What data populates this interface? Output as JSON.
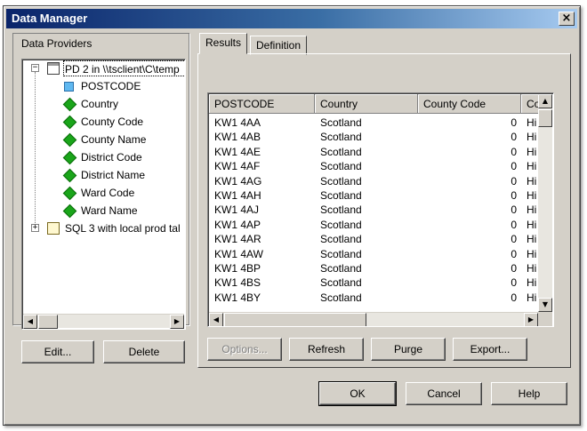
{
  "window": {
    "title": "Data Manager",
    "close_label": "×"
  },
  "providers": {
    "group_label": "Data Providers",
    "tree": [
      {
        "label": "PD 2 in \\\\tsclient\\C\\temp",
        "expander": "−",
        "children": [
          "POSTCODE",
          "Country",
          "County Code",
          "County Name",
          "District Code",
          "District Name",
          "Ward Code",
          "Ward Name"
        ]
      },
      {
        "label": "SQL 3 with local prod tal",
        "expander": "+"
      }
    ],
    "buttons": {
      "edit": "Edit...",
      "delete": "Delete"
    }
  },
  "tabs": {
    "results": "Results",
    "definition": "Definition"
  },
  "grid": {
    "columns": [
      "POSTCODE",
      "Country",
      "County Code",
      "Co"
    ],
    "rows": [
      [
        "KW1 4AA",
        "Scotland",
        "0",
        "Hi"
      ],
      [
        "KW1 4AB",
        "Scotland",
        "0",
        "Hi"
      ],
      [
        "KW1 4AE",
        "Scotland",
        "0",
        "Hi"
      ],
      [
        "KW1 4AF",
        "Scotland",
        "0",
        "Hi"
      ],
      [
        "KW1 4AG",
        "Scotland",
        "0",
        "Hi"
      ],
      [
        "KW1 4AH",
        "Scotland",
        "0",
        "Hi"
      ],
      [
        "KW1 4AJ",
        "Scotland",
        "0",
        "Hi"
      ],
      [
        "KW1 4AP",
        "Scotland",
        "0",
        "Hi"
      ],
      [
        "KW1 4AR",
        "Scotland",
        "0",
        "Hi"
      ],
      [
        "KW1 4AW",
        "Scotland",
        "0",
        "Hi"
      ],
      [
        "KW1 4BP",
        "Scotland",
        "0",
        "Hi"
      ],
      [
        "KW1 4BS",
        "Scotland",
        "0",
        "Hi"
      ],
      [
        "KW1 4BY",
        "Scotland",
        "0",
        "Hi"
      ]
    ]
  },
  "actions": {
    "options": "Options...",
    "refresh": "Refresh",
    "purge": "Purge",
    "export": "Export..."
  },
  "dialog_buttons": {
    "ok": "OK",
    "cancel": "Cancel",
    "help": "Help"
  },
  "colors": {
    "face": "#d4d0c8",
    "title_start": "#0a246a",
    "field_icon": "#1aa51a"
  }
}
